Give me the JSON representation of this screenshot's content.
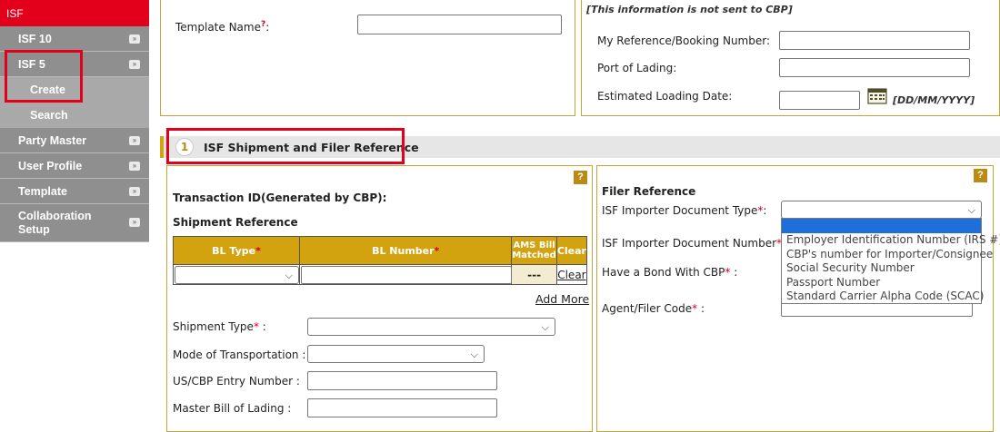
{
  "sidebar": {
    "header": "ISF",
    "items": [
      {
        "label": "ISF 10",
        "arrow": "»"
      },
      {
        "label": "ISF 5",
        "arrow": "»"
      }
    ],
    "sub_items": [
      "Create",
      "Search"
    ],
    "items2": [
      {
        "label": "Party Master",
        "arrow": "»"
      },
      {
        "label": "User Profile",
        "arrow": "»"
      },
      {
        "label": "Template",
        "arrow": "»"
      },
      {
        "label": "Collaboration Setup",
        "arrow": "»"
      }
    ]
  },
  "top": {
    "template_name_label": "Template Name",
    "template_name_mark": "?",
    "template_name_colon": ":",
    "not_sent_note": "[This information is not sent to CBP]",
    "my_reference_label": "My Reference/Booking Number:",
    "port_of_lading_label": "Port of Lading:",
    "loading_date_label": "Estimated Loading Date:",
    "date_format": "[DD/MM/YYYY]"
  },
  "section": {
    "number": "1",
    "title": "ISF Shipment and Filer Reference"
  },
  "left": {
    "help": "?",
    "transaction_id_label": "Transaction ID(Generated by CBP):",
    "shipment_reference_label": "Shipment Reference",
    "table": {
      "headers": {
        "bl_type": "BL Type",
        "bl_number": "BL Number",
        "ams": "AMS Bill Matched",
        "clear": "Clear"
      },
      "row": {
        "ams": "---",
        "clear": "Clear"
      }
    },
    "add_more": "Add More",
    "shipment_type_label": "Shipment Type",
    "mode_label": "Mode of Transportation :",
    "entry_number_label": "US/CBP Entry Number :",
    "master_bill_label": "Master Bill of Lading :"
  },
  "right": {
    "help": "?",
    "filer_reference_label": "Filer Reference",
    "importer_doc_type_label": "ISF Importer Document Type",
    "importer_doc_number_label": "ISF Importer Document Number",
    "bond_label": "Have a Bond With CBP",
    "agent_code_label": "Agent/Filer Code",
    "dropdown_options": [
      "Employer Identification Number (IRS #)",
      "CBP's number for Importer/Consignee",
      "Social Security Number",
      "Passport Number",
      "Standard Carrier Alpha Code (SCAC)"
    ]
  },
  "colors": {
    "brand_red": "#e3001b",
    "gold": "#d3a20f",
    "sidebar_gray": "#8f8f8f",
    "selection_blue": "#1e6fd9"
  }
}
